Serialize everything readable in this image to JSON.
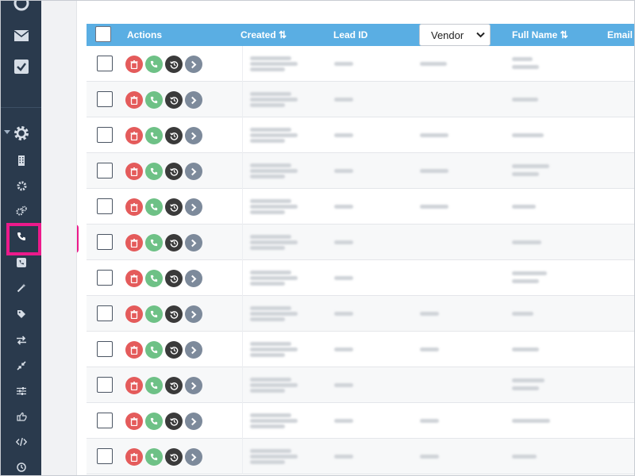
{
  "table": {
    "headers": {
      "actions": "Actions",
      "created": "Created ⇅",
      "lead_id": "Lead ID",
      "vendor": "Vendor",
      "full_name": "Full Name ⇅",
      "email": "Email"
    },
    "row_count": 12,
    "row_actions": [
      "delete",
      "call",
      "history",
      "open"
    ]
  },
  "sidebar": {
    "top_icons": [
      "refresh-icon",
      "mail-icon",
      "checkbox-icon"
    ],
    "section_icon": "gear-icon",
    "items": [
      "building-icon",
      "cog-icon",
      "cogs-icon",
      "phone-icon",
      "phone-square-icon",
      "wand-icon",
      "tag-icon",
      "exchange-icon",
      "compress-icon",
      "sliders-icon",
      "hand-point-icon",
      "code-icon",
      "clock-icon"
    ],
    "active_item": "phone-icon"
  },
  "colors": {
    "sidebar": "#2a3a4d",
    "header": "#5aaee3",
    "highlight": "#ec1a8b",
    "delete": "#e45b5b",
    "call": "#6ec186",
    "history": "#3a3a3a",
    "open": "#7d8a9b"
  }
}
